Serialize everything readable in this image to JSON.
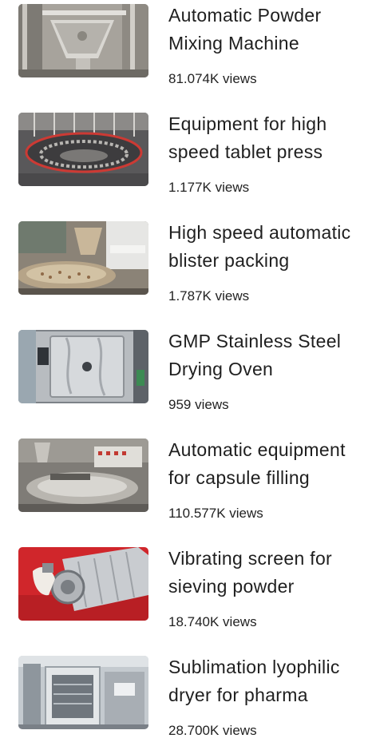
{
  "videos": [
    {
      "title": "Automatic Powder Mixing Machine",
      "views": "81.074K views",
      "thumb_icon": "powder-mixer-thumbnail",
      "tone": "#9a9690"
    },
    {
      "title": "Equipment for high speed tablet press",
      "views": "1.177K views",
      "thumb_icon": "rotary-press-thumbnail",
      "tone": "#6e6e70"
    },
    {
      "title": "High speed automatic blister packing",
      "views": "1.787K views",
      "thumb_icon": "blister-machine-thumbnail",
      "tone": "#8a8070"
    },
    {
      "title": "GMP Stainless Steel Drying Oven",
      "views": "959 views",
      "thumb_icon": "drying-oven-thumbnail",
      "tone": "#8d9299"
    },
    {
      "title": "Automatic equipment for capsule filling",
      "views": "110.577K views",
      "thumb_icon": "capsule-filler-thumbnail",
      "tone": "#8b8882"
    },
    {
      "title": "Vibrating screen for sieving powder",
      "views": "18.740K views",
      "thumb_icon": "vibrating-screen-thumbnail",
      "tone": "#c8282c"
    },
    {
      "title": "Sublimation lyophilic dryer for pharma",
      "views": "28.700K views",
      "thumb_icon": "lyophilic-dryer-thumbnail",
      "tone": "#b9c0c6"
    }
  ]
}
